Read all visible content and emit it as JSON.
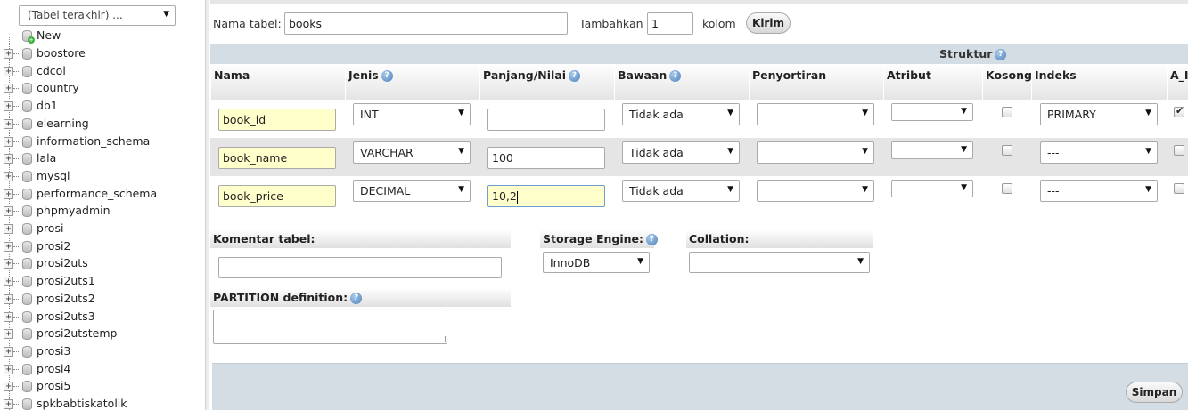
{
  "sidebar": {
    "recent_tables": "(Tabel terakhir) ...",
    "new_label": "New",
    "databases": [
      "boostore",
      "cdcol",
      "country",
      "db1",
      "elearning",
      "information_schema",
      "lala",
      "mysql",
      "performance_schema",
      "phpmyadmin",
      "prosi",
      "prosi2",
      "prosi2uts",
      "prosi2uts1",
      "prosi2uts2",
      "prosi2uts3",
      "prosi2utstemp",
      "prosi3",
      "prosi4",
      "prosi5",
      "spkbabtiskatolik"
    ]
  },
  "form": {
    "table_name_label": "Nama tabel:",
    "table_name_value": "books",
    "add_label": "Tambahkan",
    "add_count": "1",
    "columns_label": "kolom",
    "submit_label": "Kirim"
  },
  "structure": {
    "title": "Struktur",
    "headers": [
      "Nama",
      "Jenis",
      "Panjang/Nilai",
      "Bawaan",
      "Penyortiran",
      "Atribut",
      "Kosong",
      "Indeks",
      "A_I"
    ],
    "rows": [
      {
        "name": "book_id",
        "type": "INT",
        "length": "",
        "default": "Tidak ada",
        "collation": "",
        "attribute": "",
        "null": false,
        "index": "PRIMARY",
        "ai": true
      },
      {
        "name": "book_name",
        "type": "VARCHAR",
        "length": "100",
        "default": "Tidak ada",
        "collation": "",
        "attribute": "",
        "null": false,
        "index": "---",
        "ai": false
      },
      {
        "name": "book_price",
        "type": "DECIMAL",
        "length": "10,2",
        "default": "Tidak ada",
        "collation": "",
        "attribute": "",
        "null": false,
        "index": "---",
        "ai": false
      }
    ]
  },
  "options": {
    "comment_label": "Komentar tabel:",
    "comment_value": "",
    "engine_label": "Storage Engine:",
    "engine_value": "InnoDB",
    "collation_label": "Collation:",
    "collation_value": "",
    "partition_label": "PARTITION definition:"
  },
  "footer": {
    "save_label": "Simpan"
  },
  "icons": {
    "help": "help-icon",
    "expand": "plus-expander-icon",
    "database": "database-icon",
    "dropdown": "chevron-down-icon",
    "check": "checkmark-icon"
  },
  "colors": {
    "header_bar": "#d5dde4",
    "highlight_input": "#ffffcc",
    "even_row": "#e5e5e5"
  }
}
